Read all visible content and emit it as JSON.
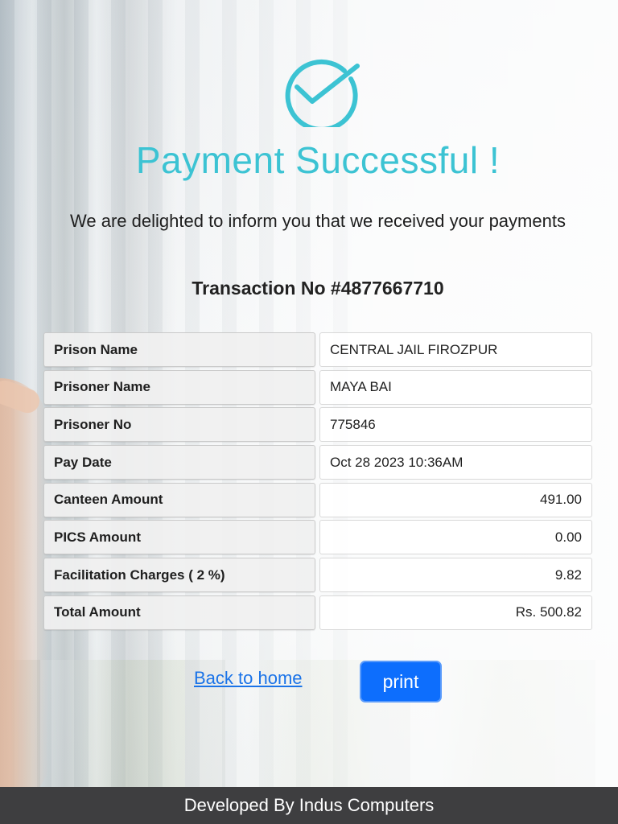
{
  "colors": {
    "accent": "#3cc3d3",
    "link": "#1a73e8",
    "button": "#0d6efd",
    "footer_bg": "#3e3e40"
  },
  "icon": "check-circle-icon",
  "title": "Payment Successful !",
  "subtitle": "We are delighted to inform you that we received your payments",
  "transaction": {
    "label": "Transaction No",
    "number": "#4877667710"
  },
  "details": [
    {
      "label": "Prison Name",
      "value": "CENTRAL JAIL FIROZPUR"
    },
    {
      "label": "Prisoner Name",
      "value": "MAYA BAI"
    },
    {
      "label": "Prisoner No",
      "value": "775846"
    },
    {
      "label": "Pay Date",
      "value": "Oct 28 2023 10:36AM"
    },
    {
      "label": "Canteen Amount",
      "value": "491.00"
    },
    {
      "label": "PICS Amount",
      "value": "0.00"
    },
    {
      "label": "Facilitation Charges ( 2 %)",
      "value": "9.82"
    },
    {
      "label": "Total Amount",
      "value": "Rs. 500.82"
    }
  ],
  "actions": {
    "back_label": "Back to home",
    "print_label": "print"
  },
  "footer": "Developed By Indus Computers"
}
